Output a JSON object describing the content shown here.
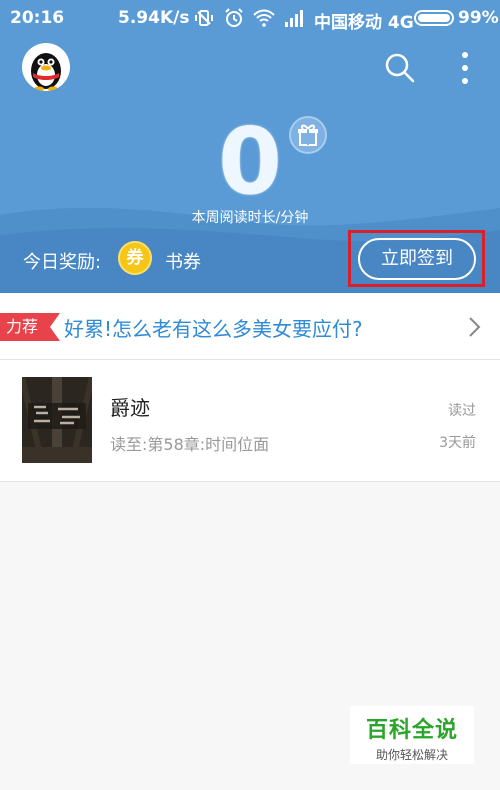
{
  "status_bar": {
    "time": "20:16",
    "speed": "5.94K/s",
    "carrier": "中国移动 4G",
    "battery_percent": "99%",
    "battery_level": 0.99
  },
  "header": {
    "weekly_read_value": "0",
    "weekly_read_label": "本周阅读时长/分钟",
    "reward_label": "今日奖励:",
    "coupon_icon_text": "券",
    "coupon_label": "书券",
    "checkin_button_label": "立即签到"
  },
  "recommendation": {
    "badge": "力荐",
    "text": "好累!怎么老有这么多美女要应付?"
  },
  "books": [
    {
      "title": "爵迹",
      "progress": "读至:第58章:时间位面",
      "status": "读过",
      "time_ago": "3天前"
    }
  ],
  "watermark": {
    "main": "百科全说",
    "sub": "助你轻松解决"
  },
  "colors": {
    "header_blue": "#5a9bd5",
    "accent_red": "#e8424b",
    "link_blue": "#2f8ad8",
    "coin_yellow": "#f5c518"
  },
  "icons": {
    "avatar": "qq-penguin-avatar",
    "search": "search-icon",
    "more": "more-vertical-icon",
    "gift": "gift-icon",
    "chevron": "chevron-right-icon"
  }
}
